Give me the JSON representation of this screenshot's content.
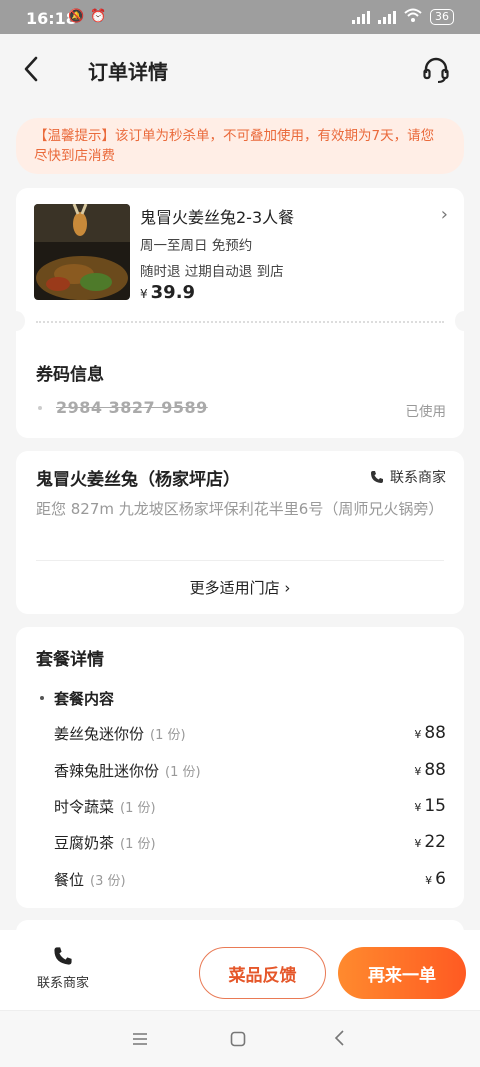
{
  "status_bar": {
    "time": "16:18",
    "battery": "36"
  },
  "header": {
    "title": "订单详情"
  },
  "notice": {
    "text": "【温馨提示】该订单为秒杀单，不可叠加使用，有效期为7天，请您尽快到店消费"
  },
  "product": {
    "name": "鬼冒火姜丝兔2-3人餐",
    "tags_line1": "周一至周日   免预约",
    "tags_line2": "随时退   过期自动退   到店",
    "currency": "¥",
    "price": "39.9"
  },
  "coupon": {
    "title": "券码信息",
    "code": "2984 3827 9589",
    "status": "已使用"
  },
  "store": {
    "name": "鬼冒火姜丝兔（杨家坪店）",
    "contact_label": "联系商家",
    "address": "距您 827m 九龙坡区杨家坪保利花半里6号（周师兄火锅旁）",
    "more_stores": "更多适用门店"
  },
  "package": {
    "title": "套餐详情",
    "subtitle": "套餐内容",
    "items": [
      {
        "name": "姜丝兔迷你份",
        "qty": "(1 份)",
        "currency": "¥",
        "price": "88"
      },
      {
        "name": "香辣兔肚迷你份",
        "qty": "(1 份)",
        "currency": "¥",
        "price": "88"
      },
      {
        "name": "时令蔬菜",
        "qty": "(1 份)",
        "currency": "¥",
        "price": "15"
      },
      {
        "name": "豆腐奶茶",
        "qty": "(1 份)",
        "currency": "¥",
        "price": "22"
      },
      {
        "name": "餐位",
        "qty": "(3 份)",
        "currency": "¥",
        "price": "6"
      }
    ]
  },
  "bottom_bar": {
    "contact_label": "联系商家",
    "feedback_label": "菜品反馈",
    "reorder_label": "再来一单"
  },
  "colors": {
    "accent": "#ff6a2a",
    "notice_bg": "#ffeee6",
    "notice_text": "#ea6a3b"
  }
}
